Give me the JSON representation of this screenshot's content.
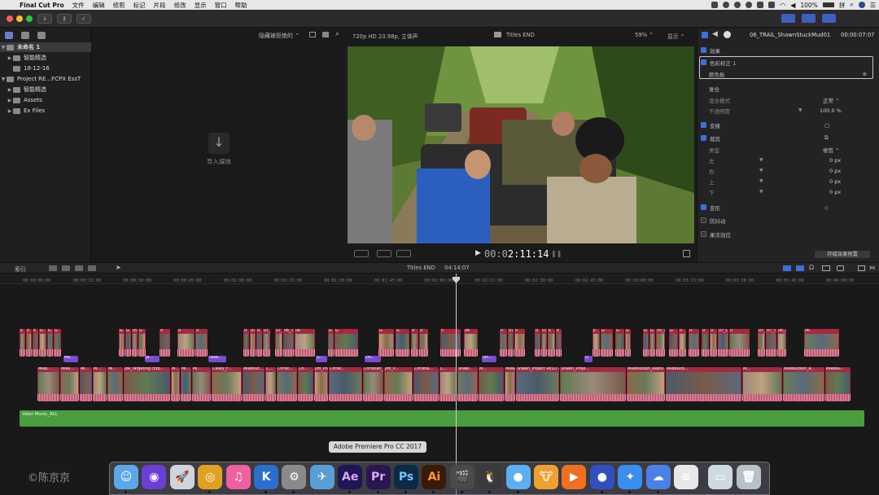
{
  "menubar": {
    "app_name": "Final Cut Pro",
    "items": [
      "文件",
      "编辑",
      "修剪",
      "标记",
      "片段",
      "修改",
      "显示",
      "窗口",
      "帮助"
    ],
    "battery": "100%",
    "input_method": "拼"
  },
  "library": {
    "items": [
      {
        "label": "未命名 1"
      },
      {
        "label": "智能精选"
      },
      {
        "label": "18-12-16"
      },
      {
        "label": "Project RE...FCPX EssT"
      },
      {
        "label": "智能精选"
      },
      {
        "label": "Assets"
      },
      {
        "label": "Ex Files"
      }
    ]
  },
  "browser": {
    "filter_label": "隐藏被拒绝的 ⌃",
    "import_label": "导入媒体",
    "import_icon": "↓"
  },
  "viewer": {
    "format": "720p HD 23.98p, 立体声",
    "clip_title": "Titles END",
    "zoom": "59% ⌃",
    "display_menu": "显示 ⌃",
    "timecode_dim": "00:0",
    "timecode": "2:11:14",
    "play_icon": "▶",
    "pause_icon": "❚❚"
  },
  "inspector": {
    "clip_name": "06_TRAIL_ShawnStuckMud01",
    "duration": "00:00:07:07",
    "rows": [
      {
        "label": "效果",
        "value": ""
      },
      {
        "label": "色彩校正 1",
        "value": ""
      },
      {
        "label": "颜色板",
        "value": "⊕"
      },
      {
        "label": "复合",
        "value": ""
      },
      {
        "label": "混合模式",
        "value": "正常 ⌃"
      },
      {
        "label": "不透明度",
        "value": "100.0 %"
      },
      {
        "label": "变换",
        "value": "▢"
      },
      {
        "label": "裁剪",
        "value": "⧉"
      },
      {
        "label": "类型",
        "value": "修剪 ⌃"
      },
      {
        "label": "左",
        "value": "0 px"
      },
      {
        "label": "右",
        "value": "0 px"
      },
      {
        "label": "上",
        "value": "0 px"
      },
      {
        "label": "下",
        "value": "0 px"
      },
      {
        "label": "变形",
        "value": "◇"
      },
      {
        "label": "防抖动",
        "value": ""
      },
      {
        "label": "果冻效应",
        "value": ""
      }
    ],
    "save_preset": "存储效果预置"
  },
  "timeline": {
    "index_label": "索引",
    "title": "Titles END",
    "duration": "04:14:07",
    "ticks": [
      "00:00:00:00",
      "00:00:15:00",
      "00:00:30:00",
      "00:00:45:00",
      "00:01:00:00",
      "00:01:15:00",
      "00:01:30:00",
      "00:01:45:00",
      "00:02:00:00",
      "00:02:15:00",
      "00:02:30:00",
      "00:02:45:00",
      "00:03:00:00",
      "00:03:15:00",
      "00:03:30:00",
      "00:03:45:00",
      "00:04:00:00"
    ],
    "top_clips": [
      "E",
      "E",
      "E",
      "G",
      "G",
      "G",
      "G",
      "G",
      "05_C...",
      "G",
      "0",
      "0",
      "0",
      "0",
      "07_CA",
      "0",
      "07_TR",
      "07_T...",
      "06_TR",
      "06",
      "G",
      "G",
      "G",
      "G",
      "0",
      "0",
      "0",
      "06",
      "0",
      "07",
      "0",
      "0",
      "07_CAMP_Dr..."
    ],
    "title_clips": [
      "Ma...",
      "Jo...",
      "case...",
      "S...",
      "chi...",
      "SH...",
      "O"
    ],
    "primary_clips": [
      "Mike...",
      "Mike...",
      "Mi...",
      "M...",
      "Mi...",
      "Joe_targeting corp...",
      "M...",
      "Mi...",
      "Mi...",
      "Casey_F...",
      "MikeNut...",
      "C...",
      "Christ...",
      "Ch...",
      "Jim_Project R...",
      "Christ...",
      "Christian_...",
      "Jim_P...",
      "Christia...",
      "C...",
      "Shaw...",
      "M...",
      "MikeNutson_ex...",
      "Shawn_Project RELO is a 4-...",
      "Shawn_Proje...",
      "MikeNutson_execs become foll...",
      "MikeNuts...",
      "M...",
      "MikeNutson_a...",
      "MikeNu..."
    ],
    "music_label": "Valor Music_ALL"
  },
  "dock": {
    "tooltip": "Adobe Premiere Pro CC 2017",
    "apps": [
      {
        "name": "Finder",
        "glyph": "☺",
        "color": "#5aa8e8"
      },
      {
        "name": "Siri",
        "glyph": "◉",
        "color": "#6b3fd6"
      },
      {
        "name": "Launchpad",
        "glyph": "🚀",
        "color": "#cfd4da"
      },
      {
        "name": "Chrome",
        "glyph": "◎",
        "color": "#e0a020"
      },
      {
        "name": "iTunes",
        "glyph": "♫",
        "color": "#f060a0"
      },
      {
        "name": "Kuaibo",
        "glyph": "K",
        "color": "#2a6fd0"
      },
      {
        "name": "System Preferences",
        "glyph": "⚙",
        "color": "#8a8a8a"
      },
      {
        "name": "Swift",
        "glyph": "✈",
        "color": "#5a9ed8"
      },
      {
        "name": "After Effects",
        "glyph": "Ae",
        "color": "#1e1656"
      },
      {
        "name": "Premiere Pro",
        "glyph": "Pr",
        "color": "#2a1650"
      },
      {
        "name": "Photoshop",
        "glyph": "Ps",
        "color": "#0d2a44"
      },
      {
        "name": "Illustrator",
        "glyph": "Ai",
        "color": "#3a1a05"
      },
      {
        "name": "Final Cut Pro",
        "glyph": "🎬",
        "color": "#4a4a4a"
      },
      {
        "name": "QQ",
        "glyph": "🐧",
        "color": "#3a3a3a"
      },
      {
        "name": "QQ Browser",
        "glyph": "●",
        "color": "#5ab0f0"
      },
      {
        "name": "Cow",
        "glyph": "🐮",
        "color": "#f0a030"
      },
      {
        "name": "Infuse",
        "glyph": "▶",
        "color": "#f07020"
      },
      {
        "name": "Screen Recorder",
        "glyph": "●",
        "color": "#3050c0"
      },
      {
        "name": "Safari",
        "glyph": "✦",
        "color": "#3a8ef0"
      },
      {
        "name": "Baidu Netdisk",
        "glyph": "☁",
        "color": "#4a80e8"
      },
      {
        "name": "TextEdit",
        "glyph": "≡",
        "color": "#e8e8e8"
      },
      {
        "name": "Preview",
        "glyph": "▭",
        "color": "#d0d8e0"
      },
      {
        "name": "Trash",
        "glyph": "🗑",
        "color": "#b8c0c8"
      }
    ]
  },
  "watermark": "©陈京京"
}
